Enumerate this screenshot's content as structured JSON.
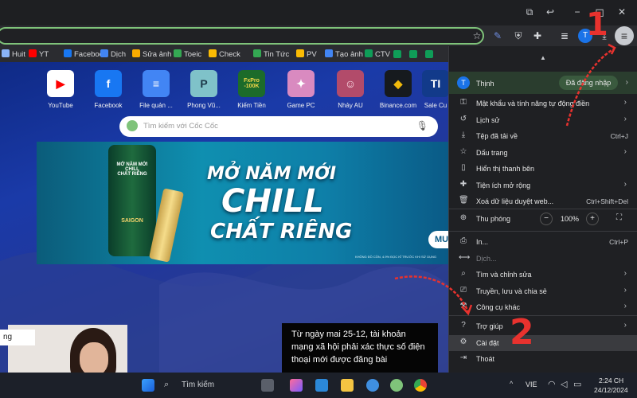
{
  "bookmarks": [
    {
      "label": "Huit",
      "color": "#8ab4f8"
    },
    {
      "label": "YT",
      "color": "#ff0000"
    },
    {
      "label": "Facebook",
      "color": "#1877f2"
    },
    {
      "label": "Dịch",
      "color": "#4285f4"
    },
    {
      "label": "Sửa ảnh",
      "color": "#f9ab00"
    },
    {
      "label": "Toeic",
      "color": "#34a853"
    },
    {
      "label": "Check",
      "color": "#fbbc04"
    },
    {
      "label": "Tin Tức",
      "color": "#34a853"
    },
    {
      "label": "PV",
      "color": "#fbbc04"
    },
    {
      "label": "Tạo ảnh",
      "color": "#4285f4"
    },
    {
      "label": "CTV",
      "color": "#0f9d58"
    }
  ],
  "shortcuts": [
    {
      "label": "YouTube",
      "glyph": "▶",
      "bg": "#ffffff",
      "fg": "#ff0000"
    },
    {
      "label": "Facebook",
      "glyph": "f",
      "bg": "#1877f2",
      "fg": "#ffffff"
    },
    {
      "label": "File quản ...",
      "glyph": "≡",
      "bg": "#4285f4",
      "fg": "#ffffff"
    },
    {
      "label": "Phong Vũ...",
      "glyph": "P",
      "bg": "#7fc2c9",
      "fg": "#1d3a4a"
    },
    {
      "label": "Kiếm Tiền",
      "glyph": "FxPro\n-100K",
      "bg": "#1c6b2a",
      "fg": "#f5d94a"
    },
    {
      "label": "Game PC",
      "glyph": "✦",
      "bg": "#d98ac0",
      "fg": "#ffffff"
    },
    {
      "label": "Nhảy AU",
      "glyph": "☺",
      "bg": "#b24b6a",
      "fg": "#ffe3ec"
    },
    {
      "label": "Binance.com",
      "glyph": "◆",
      "bg": "#161a1e",
      "fg": "#f0b90b"
    },
    {
      "label": "Sale Cu",
      "glyph": "TI",
      "bg": "#123a8a",
      "fg": "#ffffff"
    }
  ],
  "search": {
    "placeholder": "Tìm kiếm với Cốc Cốc"
  },
  "banner": {
    "line1": "MỞ NĂM MỚI",
    "line2": "CHILL",
    "line3": "CHẤT RIÊNG",
    "can_text": "MỞ NĂM MỚI\nCHILL\nCHẤT RIÊNG",
    "brand": "SAIGON",
    "cta": "MU",
    "fine": "KHÔNG ĐỒ CỒN, 4.9% ĐỌC KĨ TRƯỚC KHI SỬ DỤNG"
  },
  "news": {
    "text": "Từ ngày mai 25-12, tài khoản mạng xã hội phải xác thực số điện thoại mới được đăng bài",
    "tag": "ng"
  },
  "profile": {
    "avatar": "T",
    "name": "Thịnh",
    "status": "Đã đăng nhập"
  },
  "menu": [
    {
      "icon": "key-icon",
      "glyph": "⚿",
      "label": "Mật khẩu và tính năng tự động điền",
      "arrow": true
    },
    {
      "icon": "history-icon",
      "glyph": "↺",
      "label": "Lịch sử",
      "arrow": true
    },
    {
      "icon": "download-icon",
      "glyph": "⤓",
      "label": "Tệp đã tải về",
      "shortcut": "Ctrl+J"
    },
    {
      "icon": "star-icon",
      "glyph": "☆",
      "label": "Dấu trang",
      "arrow": true
    },
    {
      "icon": "sidebar-icon",
      "glyph": "▯",
      "label": "Hiển thị thanh bên"
    },
    {
      "icon": "extension-icon",
      "glyph": "✚",
      "label": "Tiện ích mở rộng",
      "arrow": true
    },
    {
      "icon": "trash-icon",
      "glyph": "🗑",
      "label": "Xoá dữ liệu duyệt web...",
      "shortcut": "Ctrl+Shift+Del"
    }
  ],
  "zoom": {
    "label": "Thu phóng",
    "value": "100%",
    "minus": "−",
    "plus": "+",
    "full": "⛶"
  },
  "menu2": [
    {
      "icon": "print-icon",
      "glyph": "⎙",
      "label": "In...",
      "shortcut": "Ctrl+P"
    },
    {
      "icon": "translate-icon",
      "glyph": "⟷",
      "label": "Dịch...",
      "disabled": true
    },
    {
      "icon": "find-icon",
      "glyph": "⌕",
      "label": "Tìm và chỉnh sửa",
      "arrow": true
    },
    {
      "icon": "cast-icon",
      "glyph": "⎚",
      "label": "Truyền, lưu và chia sẻ",
      "arrow": true
    },
    {
      "icon": "tools-icon",
      "glyph": "⚒",
      "label": "Công cụ khác",
      "arrow": true
    }
  ],
  "menu3": [
    {
      "icon": "help-icon",
      "glyph": "?",
      "label": "Trợ giúp",
      "arrow": true
    },
    {
      "icon": "settings-icon",
      "glyph": "⚙",
      "label": "Cài đặt",
      "highlight": true
    },
    {
      "icon": "exit-icon",
      "glyph": "⇥",
      "label": "Thoát"
    }
  ],
  "annotations": {
    "one": "1",
    "two": "2"
  },
  "taskbar": {
    "search": "Tìm kiếm",
    "lang": "VIE",
    "time": "2:24 CH",
    "date": "24/12/2024"
  },
  "colors": {
    "accent_green": "#7fc37a",
    "annotation_red": "#e8322e",
    "menu_bg": "#1f2023"
  }
}
